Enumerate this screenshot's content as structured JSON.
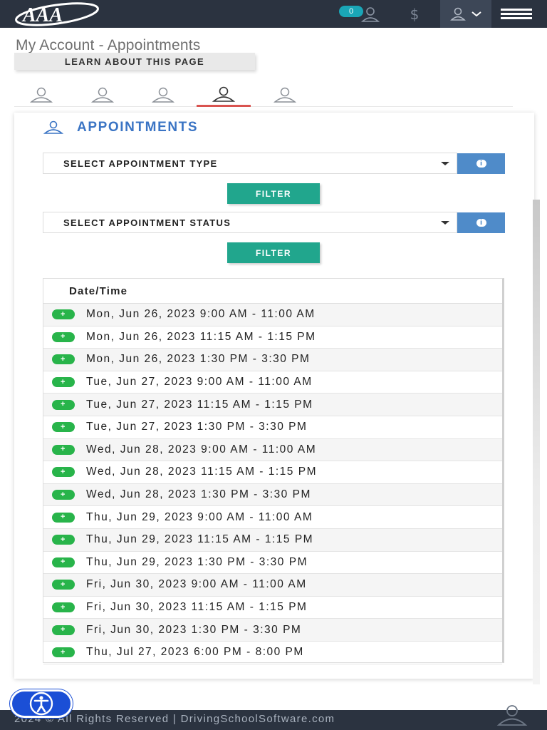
{
  "header": {
    "logo_text": "AAA",
    "notification_count": "0",
    "dollar_icon": "$",
    "menu_icon": "hamburger-icon",
    "colors": {
      "bar": "#2b3340",
      "badge": "#1aa6b7"
    }
  },
  "page": {
    "title": "My Account - Appointments",
    "learn_label": "LEARN ABOUT THIS PAGE"
  },
  "tabs": [
    {
      "icon": "user-icon",
      "active": false
    },
    {
      "icon": "user-icon",
      "active": false
    },
    {
      "icon": "user-icon",
      "active": false
    },
    {
      "icon": "user-icon",
      "active": true
    },
    {
      "icon": "user-icon",
      "active": false
    }
  ],
  "appointments": {
    "title": "APPOINTMENTS",
    "type_select": "SELECT APPOINTMENT TYPE",
    "status_select": "SELECT APPOINTMENT STATUS",
    "filter_label": "FILTER",
    "column_header": "Date/Time",
    "add_symbol": "+",
    "rows": [
      "Mon, Jun 26, 2023 9:00 AM - 11:00 AM",
      "Mon, Jun 26, 2023 11:15 AM - 1:15 PM",
      "Mon, Jun 26, 2023 1:30 PM - 3:30 PM",
      "Tue, Jun 27, 2023 9:00 AM - 11:00 AM",
      "Tue, Jun 27, 2023 11:15 AM - 1:15 PM",
      "Tue, Jun 27, 2023 1:30 PM - 3:30 PM",
      "Wed, Jun 28, 2023 9:00 AM - 11:00 AM",
      "Wed, Jun 28, 2023 11:15 AM - 1:15 PM",
      "Wed, Jun 28, 2023 1:30 PM - 3:30 PM",
      "Thu, Jun 29, 2023 9:00 AM - 11:00 AM",
      "Thu, Jun 29, 2023 11:15 AM - 1:15 PM",
      "Thu, Jun 29, 2023 1:30 PM - 3:30 PM",
      "Fri, Jun 30, 2023 9:00 AM - 11:00 AM",
      "Fri, Jun 30, 2023 11:15 AM - 1:15 PM",
      "Fri, Jun 30, 2023 1:30 PM - 3:30 PM",
      "Thu, Jul 27, 2023 6:00 PM - 8:00 PM"
    ],
    "colors": {
      "accent": "#3a74c4",
      "filter": "#21a68d",
      "info": "#4f8bc9",
      "add": "#28b44a",
      "active_tab": "#d9534f"
    }
  },
  "footer": {
    "text": "2024 © All Rights Reserved | DrivingSchoolSoftware.com",
    "accessibility_icon": "accessibility-icon"
  }
}
